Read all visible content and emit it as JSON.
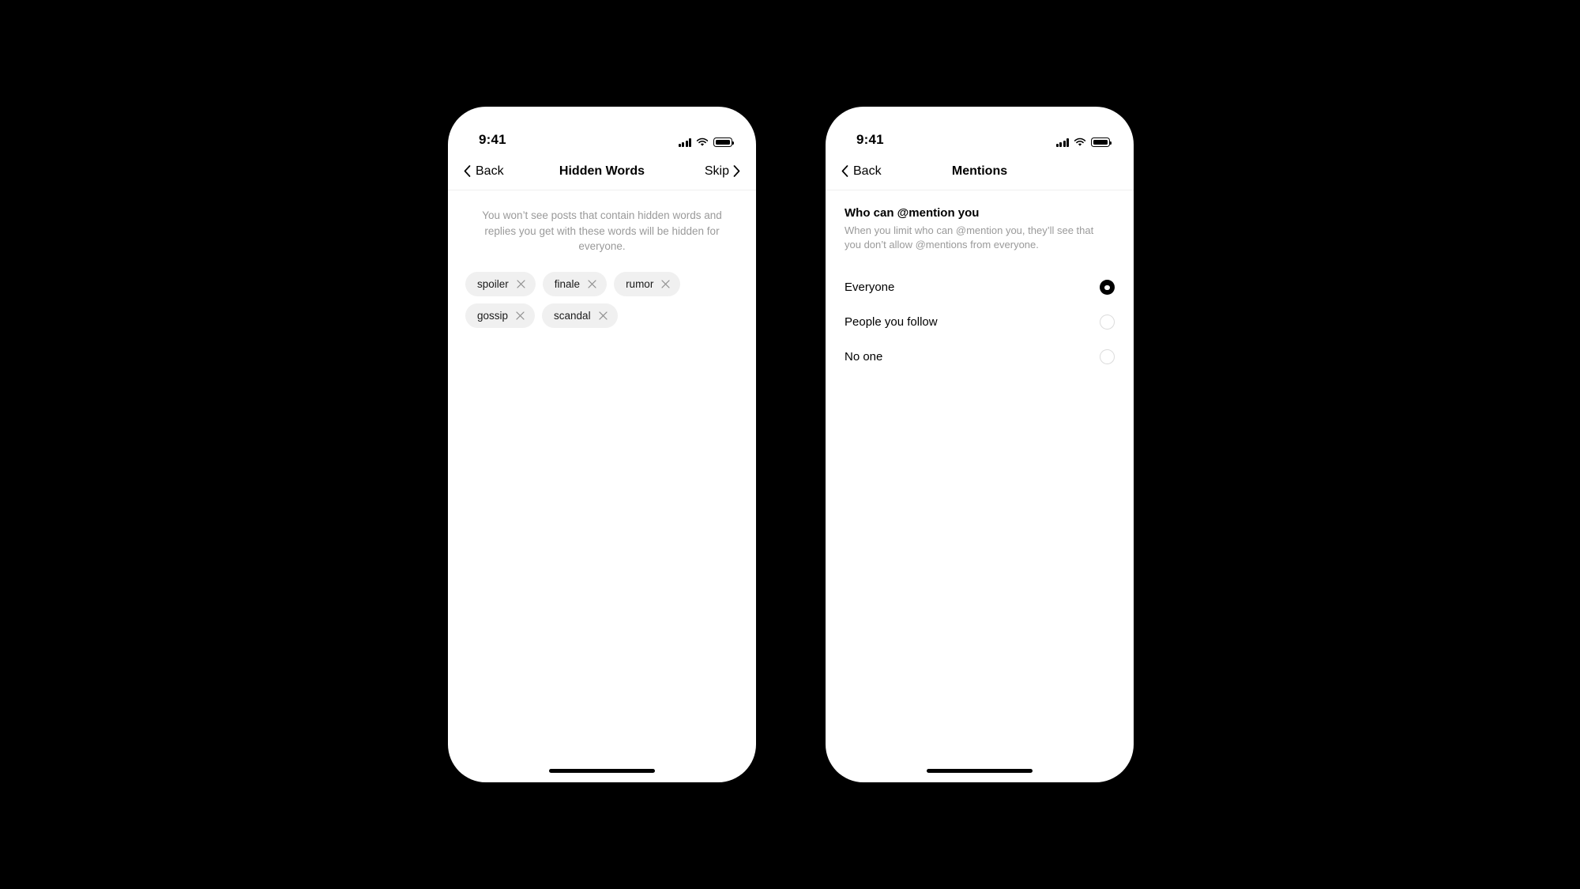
{
  "canvas": {
    "background": "#000000"
  },
  "theme": {
    "chip_bg": "#f0f0f0",
    "muted_text": "#9a9a9a",
    "accent": "#000000",
    "divider": "#efefef"
  },
  "phones": [
    {
      "id": "hidden-words",
      "status_bar": {
        "time": "9:41",
        "cellular_icon": "cellular-bars-icon",
        "wifi_icon": "wifi-icon",
        "battery_icon": "battery-full-icon"
      },
      "nav": {
        "back_label": "Back",
        "back_icon": "chevron-left-icon",
        "title": "Hidden Words",
        "skip_label": "Skip",
        "skip_icon": "chevron-right-icon"
      },
      "description": "You won’t see posts that contain hidden words and replies you get with these words will be hidden for everyone.",
      "chips": [
        {
          "label": "spoiler",
          "remove_icon": "close-x-icon"
        },
        {
          "label": "finale",
          "remove_icon": "close-x-icon"
        },
        {
          "label": "rumor",
          "remove_icon": "close-x-icon"
        },
        {
          "label": "gossip",
          "remove_icon": "close-x-icon"
        },
        {
          "label": "scandal",
          "remove_icon": "close-x-icon"
        }
      ]
    },
    {
      "id": "mentions",
      "status_bar": {
        "time": "9:41",
        "cellular_icon": "cellular-bars-icon",
        "wifi_icon": "wifi-icon",
        "battery_icon": "battery-full-icon"
      },
      "nav": {
        "back_label": "Back",
        "back_icon": "chevron-left-icon",
        "title": "Mentions"
      },
      "section": {
        "title": "Who can @mention you",
        "description": "When you limit who can @mention you, they’ll see that you don’t allow @mentions from everyone."
      },
      "options": [
        {
          "label": "Everyone",
          "selected": true
        },
        {
          "label": "People you follow",
          "selected": false
        },
        {
          "label": "No one",
          "selected": false
        }
      ]
    }
  ]
}
